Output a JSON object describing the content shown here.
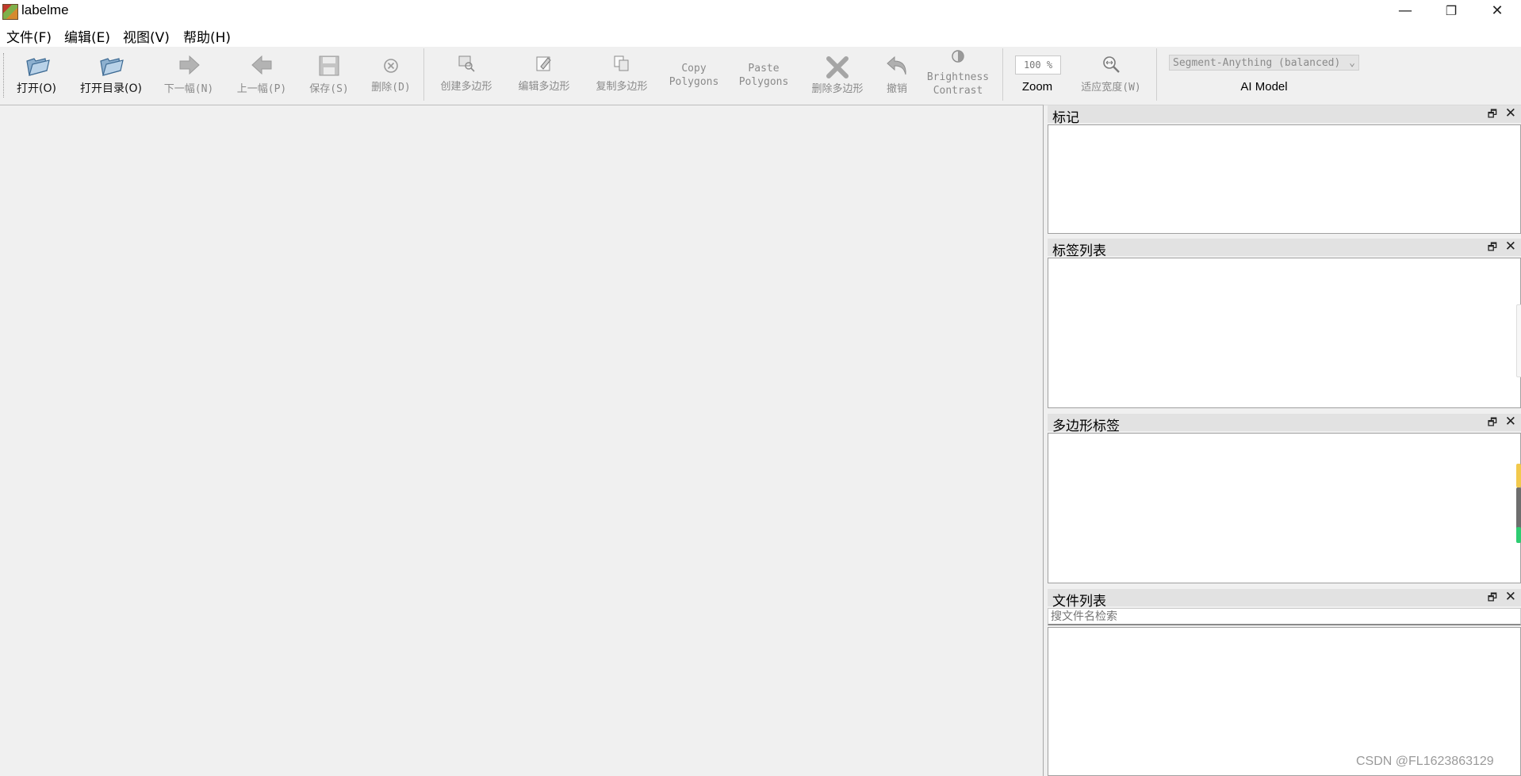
{
  "window": {
    "title": "labelme",
    "minimize": "—",
    "restore": "❐",
    "close": "✕"
  },
  "menu": [
    {
      "label": "文件(F)"
    },
    {
      "label": "编辑(E)"
    },
    {
      "label": "视图(V)"
    },
    {
      "label": "帮助(H)"
    }
  ],
  "toolbar": {
    "open": "打开(O)",
    "open_dir": "打开目录(O)",
    "next": "下一幅(N)",
    "prev": "上一幅(P)",
    "save": "保存(S)",
    "delete": "删除(D)",
    "create_polygons": "创建多边形",
    "edit_polygons": "编辑多边形",
    "duplicate_polygons": "复制多边形",
    "copy_polygons_1": "Copy",
    "copy_polygons_2": "Polygons",
    "paste_polygons_1": "Paste",
    "paste_polygons_2": "Polygons",
    "delete_polygons": "删除多边形",
    "undo": "撤销",
    "brightness_1": "Brightness",
    "brightness_2": "Contrast",
    "zoom_value": "100 %",
    "zoom_label": "Zoom",
    "fit_width": "适应宽度(W)",
    "ai_model_value": "Segment-Anything (balanced)",
    "ai_model_label": "AI Model"
  },
  "docks": {
    "flags": {
      "title": "标记",
      "float": "🗗",
      "close": "✕"
    },
    "label_list": {
      "title": "标签列表",
      "float": "🗗",
      "close": "✕"
    },
    "polygon_labels": {
      "title": "多边形标签",
      "float": "🗗",
      "close": "✕"
    },
    "file_list": {
      "title": "文件列表",
      "float": "🗗",
      "close": "✕",
      "search_placeholder": "搜文件名检索"
    }
  },
  "watermark": "CSDN @FL1623863129"
}
